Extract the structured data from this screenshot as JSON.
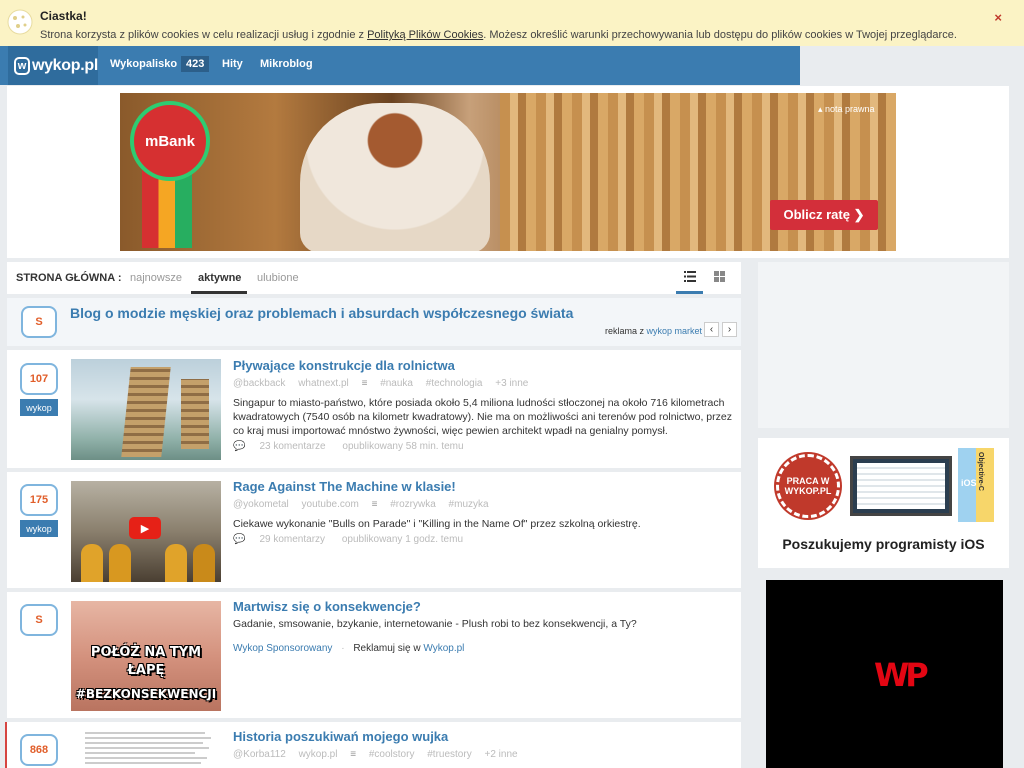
{
  "cookie": {
    "title": "Ciastka!",
    "text_before": "Strona korzysta z plików cookies w celu realizacji usług i zgodnie z ",
    "link": "Polityką Plików Cookies",
    "text_after": ". Możesz określić warunki przechowywania lub dostępu do plików cookies w Twojej przeglądarce.",
    "close": "×"
  },
  "nav": {
    "logo": "wykop.pl",
    "items": [
      {
        "label": "Wykopalisko",
        "badge": "423"
      },
      {
        "label": "Hity"
      },
      {
        "label": "Mikroblog"
      }
    ]
  },
  "banner": {
    "brand": "mBank",
    "note": "▴ nota prawna",
    "cta": "Oblicz ratę ❯"
  },
  "tabs": {
    "label": "STRONA GŁÓWNA :",
    "items": [
      "najnowsze",
      "aktywne",
      "ulubione"
    ],
    "active": "aktywne"
  },
  "promo": {
    "score": "S",
    "title": "Blog o modzie męskiej oraz problemach i absurdach współczesnego świata",
    "meta_prefix": "reklama z ",
    "meta_link": "wykop market",
    "prev": "‹",
    "next": "›"
  },
  "entries": [
    {
      "score": "107",
      "button": "wykop",
      "title": "Pływające konstrukcje dla rolnictwa",
      "author": "@backback",
      "domain": "whatnext.pl",
      "tags": [
        "#nauka",
        "#technologia"
      ],
      "more": "+3 inne",
      "desc": "Singapur to miasto-państwo, które posiada około 5,4 miliona ludności stłoczonej na około 716 kilometrach kwadratowych (7540 osób na kilometr kwadratowy). Nie ma on możliwości ani terenów pod rolnictwo, przez co kraj musi importować mnóstwo żywności, więc pewien architekt wpadł na genialny pomysł.",
      "comments": "23 komentarze",
      "published": "opublikowany 58 min. temu"
    },
    {
      "score": "175",
      "button": "wykop",
      "title": "Rage Against The Machine w klasie!",
      "author": "@yokometal",
      "domain": "youtube.com",
      "tags": [
        "#rozrywka",
        "#muzyka"
      ],
      "more": "",
      "desc": "Ciekawe wykonanie \"Bulls on Parade\" i \"Killing in the Name Of\" przez szkolną orkiestrę.",
      "comments": "29 komentarzy",
      "published": "opublikowany 1 godz. temu"
    },
    {
      "score": "S",
      "title": "Martwisz się o konsekwencje?",
      "desc": "Gadanie, smsowanie, bzykanie, internetowanie - Plush robi to bez konsekwencji, a Ty?",
      "sponsor": "Wykop Sponsorowany",
      "advertise_prefix": "Reklamuj się w ",
      "advertise_link": "Wykop.pl",
      "thumb_line1": "POŁÓŻ NA TYM",
      "thumb_line2": "ŁAPĘ",
      "thumb_line3": "#BEZKONSEKWENCJI"
    },
    {
      "score": "868",
      "title": "Historia poszukiwań mojego wujka",
      "author": "@Korba112",
      "domain": "wykop.pl",
      "tags": [
        "#coolstory",
        "#truestory"
      ],
      "more": "+2 inne"
    }
  ],
  "sidebar": {
    "praca_badge": "PRACA W WYKOP.PL",
    "book_label": "iOS",
    "book_label2": "Objective-C",
    "job_caption": "Poszukujemy programisty iOS",
    "ad_logo": "WP"
  },
  "colors": {
    "accent": "#3b7cb0",
    "score": "#e15e2a",
    "cookie_bg": "#fbf3c5"
  }
}
